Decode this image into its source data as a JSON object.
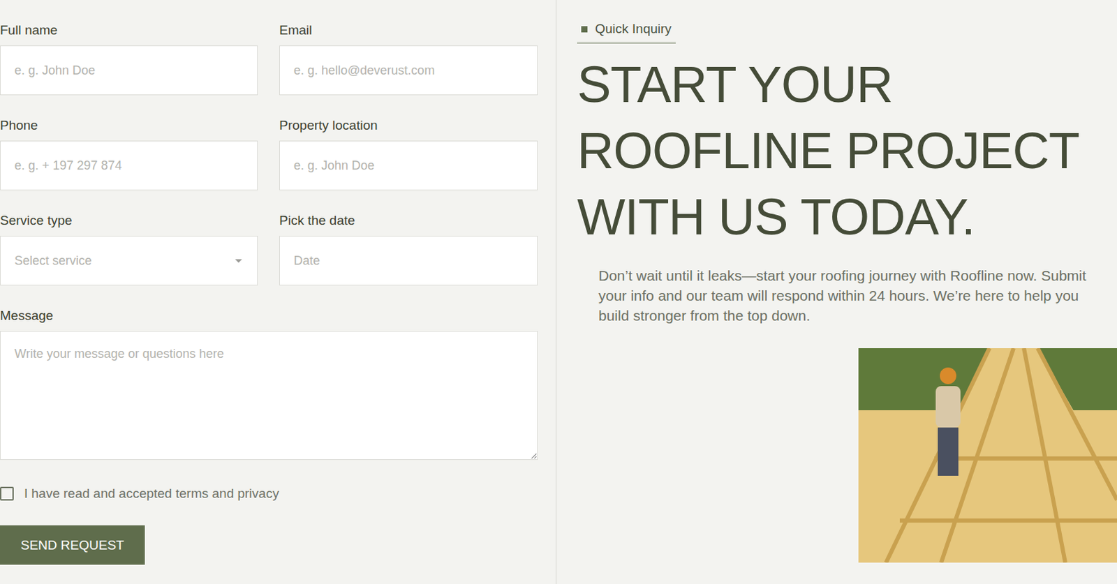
{
  "form": {
    "fields": [
      {
        "label": "Full name",
        "placeholder": "e. g. John Doe",
        "kind": "input"
      },
      {
        "label": "Email",
        "placeholder": "e. g. hello@deverust.com",
        "kind": "input"
      },
      {
        "label": "Phone",
        "placeholder": "e. g. + 197 297 874",
        "kind": "input"
      },
      {
        "label": "Property location",
        "placeholder": "e. g. John Doe",
        "kind": "input"
      },
      {
        "label": "Service type",
        "placeholder": "Select service",
        "kind": "select"
      },
      {
        "label": "Pick the date",
        "placeholder": "Date",
        "kind": "input"
      }
    ],
    "message": {
      "label": "Message",
      "placeholder": "Write your message or questions here"
    },
    "consent": {
      "label": "I have read and accepted terms and privacy",
      "checked": false
    },
    "button": "SEND REQUEST"
  },
  "intro": {
    "tag": "Quick Inquiry",
    "heading": [
      "START YOUR",
      "ROOFLINE PROJECT",
      "WITH US TODAY."
    ],
    "paragraph": "Don’t wait until it leaks—start your roofing journey with Roofline now. Submit your info and our team will respond within 24 hours. We’re here to help you build stronger from the top down."
  }
}
